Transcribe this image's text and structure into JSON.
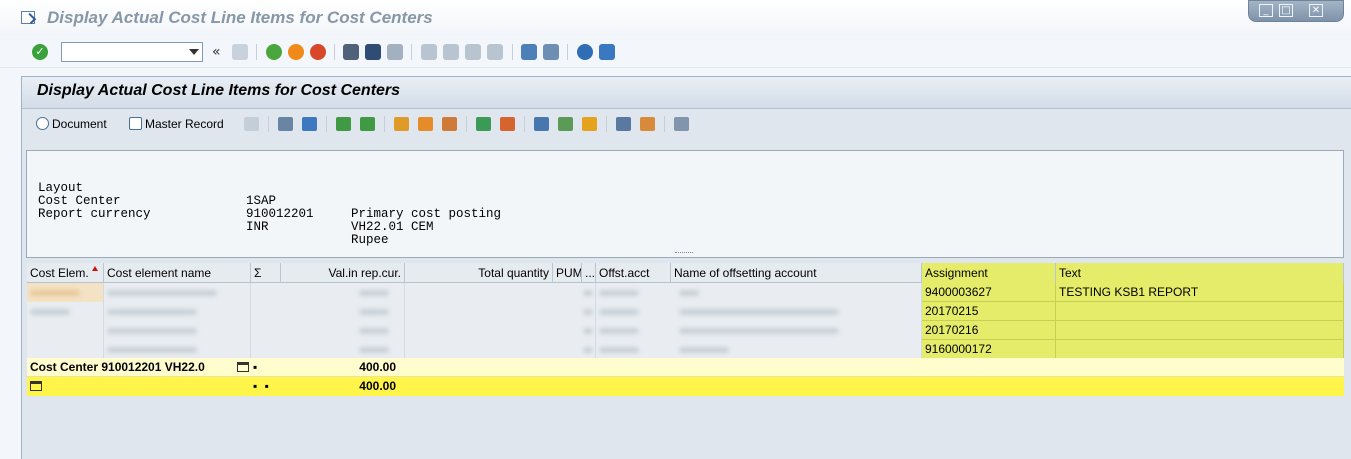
{
  "window": {
    "title": "Display Actual Cost Line Items for Cost Centers",
    "controls": [
      "_",
      "□",
      "✕"
    ]
  },
  "std_toolbar": {
    "command_field": {
      "value": "",
      "placeholder": ""
    },
    "collapse_symbol": "«"
  },
  "screen": {
    "title": "Display Actual Cost Line Items for Cost Centers",
    "buttons": {
      "document": "Document",
      "master_record": "Master Record"
    }
  },
  "header_info": [
    {
      "label": "Layout",
      "value": "1SAP",
      "desc": "Primary cost posting"
    },
    {
      "label": "Cost Center",
      "value": "910012201",
      "desc": "VH22.01 CEM"
    },
    {
      "label": "Report currency",
      "value": "INR",
      "desc": "Rupee"
    }
  ],
  "grid": {
    "columns": {
      "cost_elem": "Cost Elem.",
      "cost_elem_name": "Cost element name",
      "sigma": "Σ",
      "val_rep_cur": "Val.in rep.cur.",
      "total_qty": "Total quantity",
      "pum": "PUM",
      "dots": "...",
      "offst_acct": "Offst.acct",
      "offset_name": "Name of offsetting account",
      "assignment": "Assignment",
      "text": "Text"
    },
    "rows": [
      {
        "assignment": "9400003627",
        "text": "TESTING KSB1 REPORT"
      },
      {
        "assignment": "20170215",
        "text": ""
      },
      {
        "assignment": "20170216",
        "text": ""
      },
      {
        "assignment": "9160000172",
        "text": ""
      }
    ],
    "subtotal": {
      "label": "Cost Center 910012201 VH22.0",
      "marker": "▪",
      "value": "400.00"
    },
    "total": {
      "marker": "▪ ▪",
      "value": "400.00"
    }
  },
  "colors": {
    "assignment_highlight": "#e5ec6a",
    "subtotal_bg": "#fffccd",
    "total_bg": "#fff54a"
  }
}
